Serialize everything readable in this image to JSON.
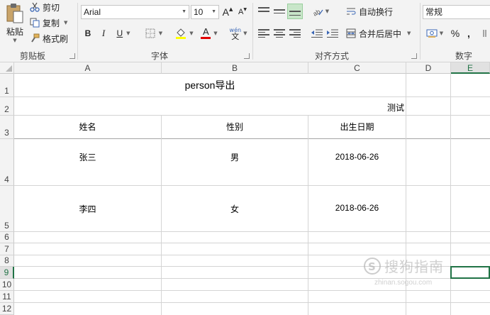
{
  "ribbon": {
    "clipboard": {
      "paste_label": "粘贴",
      "cut_label": "剪切",
      "copy_label": "复制",
      "format_painter_label": "格式刷",
      "group_label": "剪贴板"
    },
    "font": {
      "font_name": "Arial",
      "font_size": "10",
      "bold": "B",
      "italic": "I",
      "underline": "U",
      "grow_font": "A",
      "shrink_font": "A",
      "wen": "wén",
      "wen_char": "文",
      "group_label": "字体"
    },
    "alignment": {
      "wrap_text_label": "自动换行",
      "merge_center_label": "合并后居中",
      "group_label": "对齐方式"
    },
    "number": {
      "format_value": "常规",
      "percent": "%",
      "comma": ",",
      "group_label": "数字"
    }
  },
  "grid": {
    "columns": [
      "A",
      "B",
      "C",
      "D",
      "E"
    ],
    "rows": [
      "1",
      "2",
      "3",
      "4",
      "5",
      "6",
      "7",
      "8",
      "9",
      "10",
      "11",
      "12"
    ],
    "title": "person导出",
    "subtitle": "测试",
    "headers": [
      "姓名",
      "性别",
      "出生日期"
    ],
    "data": [
      [
        "张三",
        "男",
        "2018-06-26"
      ],
      [
        "李四",
        "女",
        "2018-06-26"
      ]
    ]
  },
  "watermark": {
    "brand": "搜狗指南",
    "url": "zhinan.sogou.com"
  },
  "colors": {
    "accent": "#217346",
    "font_color": "#e00000",
    "highlight": "#ffff00",
    "selected_align": "#c8e6c9"
  }
}
